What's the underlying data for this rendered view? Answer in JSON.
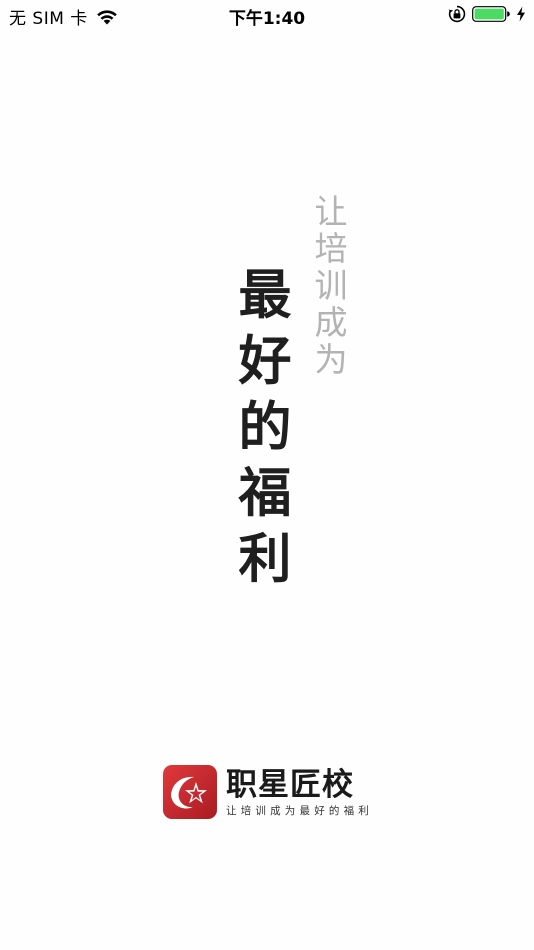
{
  "status_bar": {
    "carrier": "无 SIM 卡",
    "time": "下午1:40",
    "icons": [
      "wifi-icon",
      "orientation-lock-icon",
      "battery-icon",
      "charging-bolt-icon"
    ],
    "battery_color": "#4cd964"
  },
  "slogan": {
    "secondary": [
      "让",
      "培",
      "训",
      "成",
      "为"
    ],
    "primary": [
      "最",
      "好",
      "的",
      "福",
      "利"
    ],
    "secondary_color": "#b3b3b3",
    "primary_color": "#1f1f1f"
  },
  "brand": {
    "name": "职星匠校",
    "tagline": "让培训成为最好的福利",
    "logo_icon": "star-logo-icon",
    "logo_color": "#c8282e"
  }
}
